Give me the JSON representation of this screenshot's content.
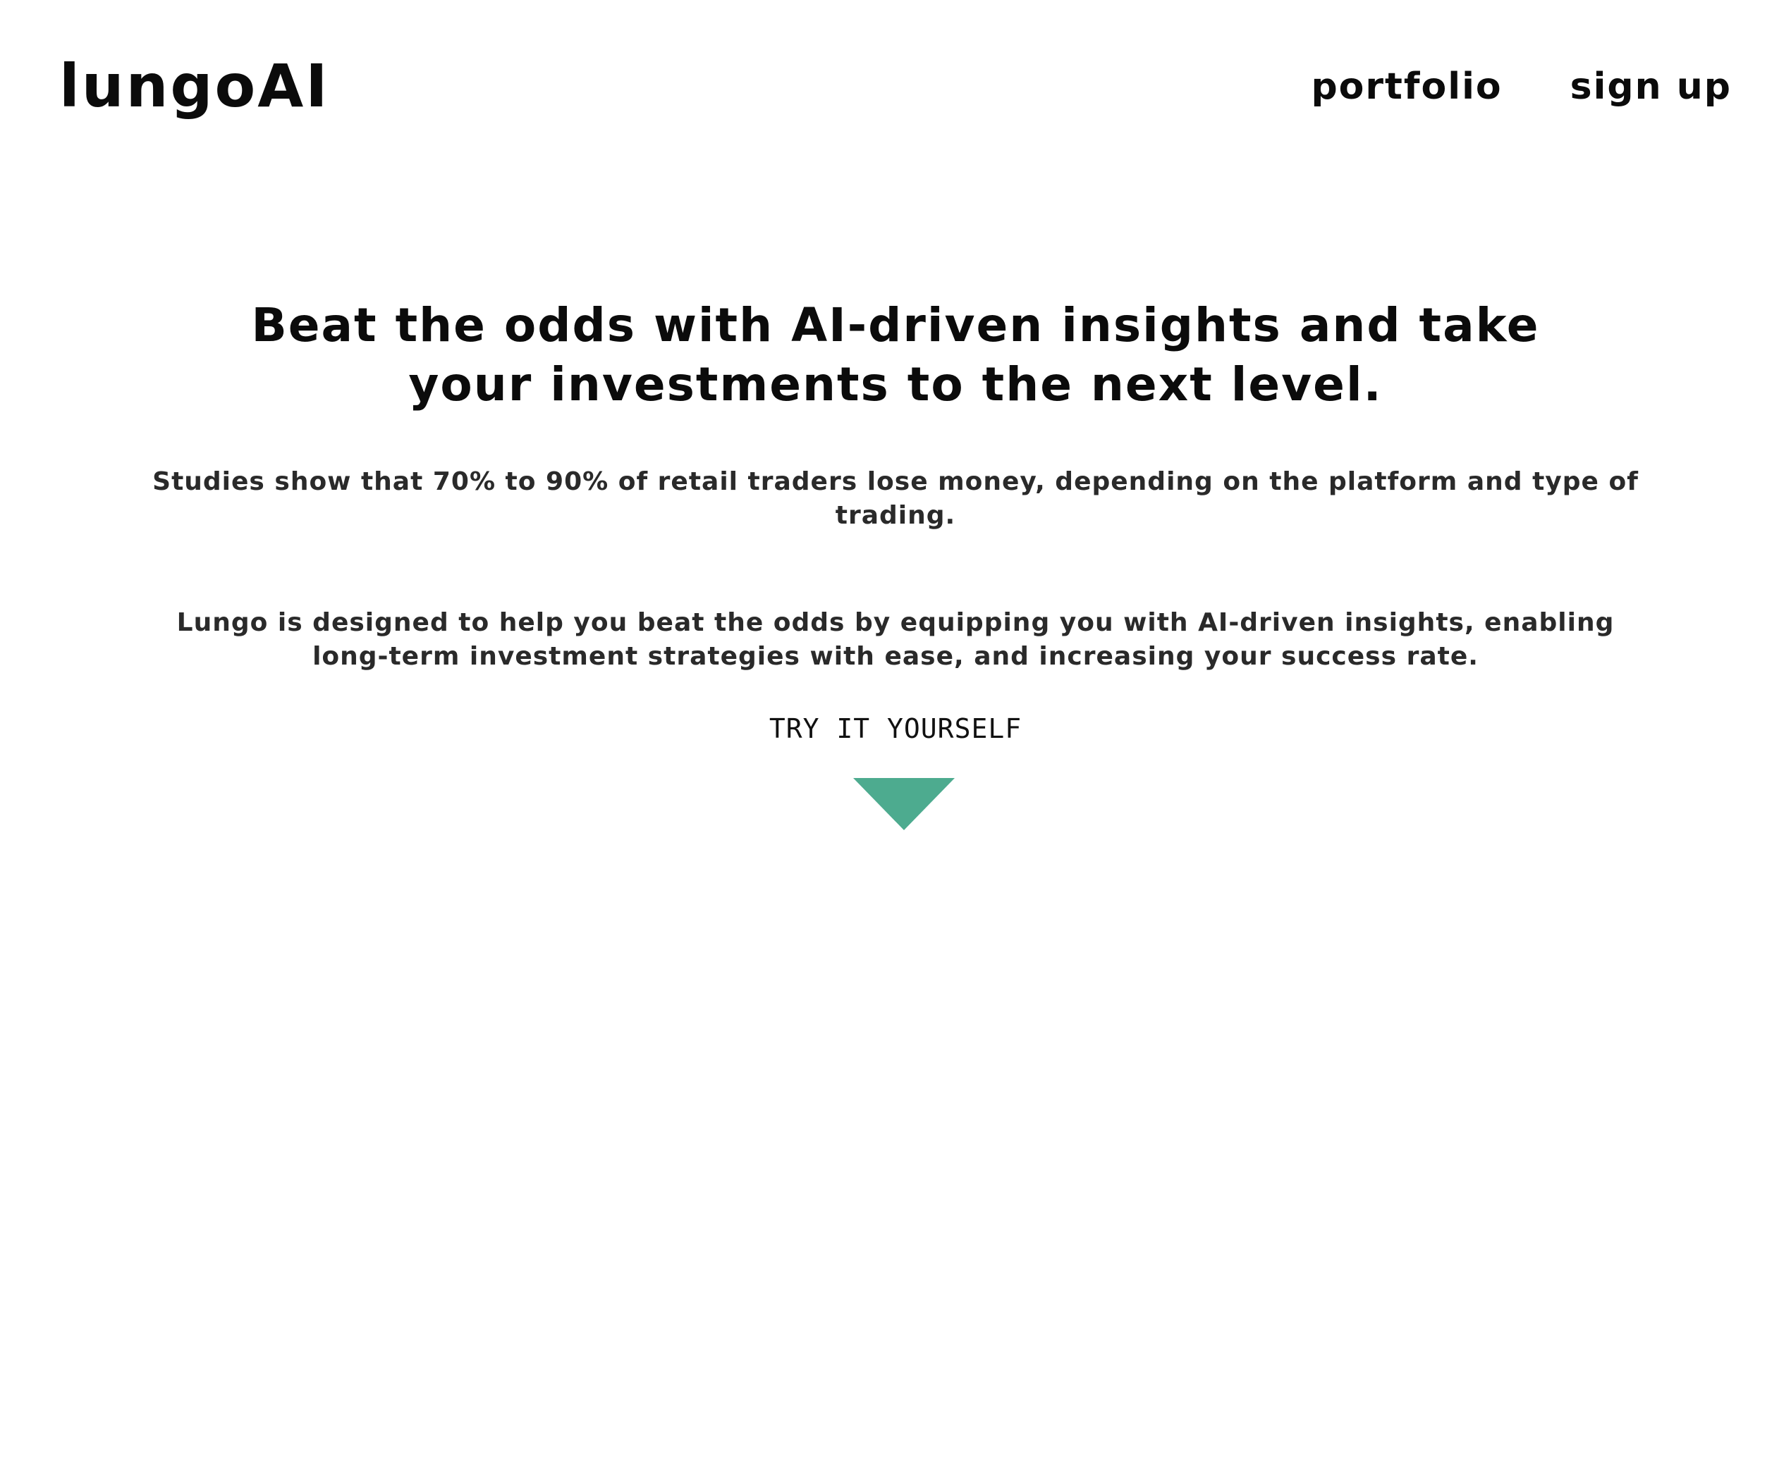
{
  "header": {
    "logo": "lungoAI",
    "nav": [
      {
        "label": "portfolio"
      },
      {
        "label": "sign up"
      }
    ]
  },
  "hero": {
    "headline": "Beat the odds with AI-driven insights and take your investments to the next level.",
    "stat": "Studies show that 70% to 90% of retail traders lose money, depending on the platform and type of trading.",
    "pitch": "Lungo is designed to help you beat the odds by equipping you with AI-driven insights, enabling long-term investment strategies with ease, and increasing your success rate."
  },
  "cta": {
    "label": "TRY IT YOURSELF",
    "icon": "triangle-down-icon",
    "accent_color": "#4dab8f"
  },
  "colors": {
    "background": "#ffffff",
    "text": "#0b0b0b",
    "body_text": "#2a2a2a",
    "accent": "#4dab8f"
  }
}
